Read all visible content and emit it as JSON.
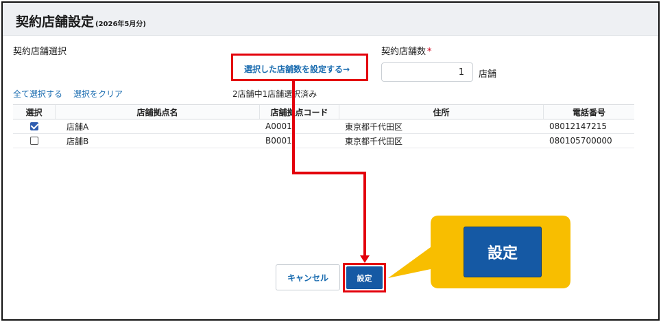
{
  "dialog": {
    "title": "契約店舗設定",
    "title_sub": "(2026年5月分)"
  },
  "store_select": {
    "label": "契約店舗選択",
    "set_count_link": "選択した店舗数を設定する→",
    "select_all": "全て選択する",
    "clear_selection": "選択をクリア",
    "status": "2店舗中1店舗選択済み"
  },
  "store_count": {
    "label": "契約店舗数",
    "required_mark": "*",
    "value": "1",
    "unit": "店舗"
  },
  "table": {
    "headers": [
      "選択",
      "店舗拠点名",
      "店舗拠点コード",
      "住所",
      "電話番号"
    ],
    "rows": [
      {
        "checked": true,
        "name": "店舗A",
        "code": "A0001",
        "address": "東京都千代田区",
        "phone": "08012147215"
      },
      {
        "checked": false,
        "name": "店舗B",
        "code": "B0001",
        "address": "東京都千代田区",
        "phone": "080105700000"
      }
    ]
  },
  "buttons": {
    "cancel": "キャンセル",
    "save": "設定"
  },
  "callout": {
    "label": "設定"
  },
  "colors": {
    "primary_button": "#1559a4",
    "link": "#1a6cb0",
    "highlight_red": "#e3000b",
    "callout_yellow": "#f8be00",
    "header_bg": "#eef0f3"
  }
}
